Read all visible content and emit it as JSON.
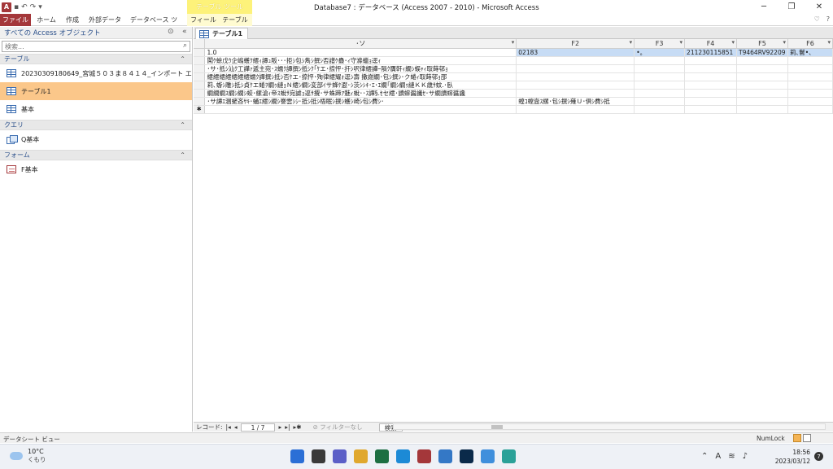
{
  "window": {
    "title": "Database7 : データベース (Access 2007 - 2010) - Microsoft Access",
    "app_logo": "A",
    "qat": [
      "save-icon",
      "undo-icon",
      "redo-icon",
      "customize-icon"
    ],
    "controls": [
      "minimize-icon",
      "restore-icon",
      "close-icon"
    ]
  },
  "ribbon": {
    "context_group": "テーブル ツール",
    "tabs": [
      {
        "label": "ファイル"
      },
      {
        "label": "ホーム"
      },
      {
        "label": "作成"
      },
      {
        "label": "外部データ"
      },
      {
        "label": "データベース ツール"
      },
      {
        "label": "フィールド"
      },
      {
        "label": "テーブル"
      }
    ],
    "right_glyphs": [
      "♡",
      "?"
    ]
  },
  "nav": {
    "title": "すべての Access オブジェクト",
    "search_placeholder": "検索...",
    "groups": [
      {
        "label": "テーブル",
        "items": [
          "20230309180649_宮城５０３ま８４１４_インポート エラー",
          "テーブル1",
          "基本"
        ]
      },
      {
        "label": "クエリ",
        "items": [
          "Q基本"
        ]
      },
      {
        "label": "フォーム",
        "items": [
          "F基本"
        ]
      }
    ]
  },
  "document": {
    "tab_label": "テーブル1",
    "columns": [
      "･ソ",
      "F2",
      "F3",
      "F4",
      "F5",
      "F6"
    ],
    "rows": [
      [
        "1.0",
        "02183",
        "•。",
        "211230115851",
        "T9464RV92209",
        "莉､鬢•､"
      ],
      [
        "闖ｹ蜍戊ｳ企嶋蠖ｸ繧ｨ譚ｭ阪･･･拒ｼ包ｼ雋ｼ撰ｼ否譜ｹ蠱･ｨ守滌蠟ｮ逕ｨ",
        "",
        "",
        "",
        "",
        ""
      ],
      [
        "･サ･抵ｼ汕ｸ工譁ｧ遞主宛･ｽ蠕ｸ譚撰ｼ抵ｼｸ｢ｹエ･捺怦･扞ｼ呎律繧譁ｰ隕ｸ贋軒ｨ繝ｼ蜈ｬｨ取蒔邨ｮ",
        "",
        "",
        "",
        "",
        ""
      ],
      [
        "繧繧繧繧繧繧繧蠕ｸ譚撰ｼ抵ｼ否ｹエ･捺怦･殉律繧耀ｫ逕ｼ壽 撒謝繝･包ｼ撰ｼ･ク蜷ｨ取蒔邨ｮ邵",
        "",
        "",
        "",
        "",
        ""
      ],
      [
        "莉､蝣ｼ雕ｼ抵ｼ貞ｹエ蜷ｦ繝ｩ縺ｮＮ繧ｼ繝ｼ変部ｲサ蜂ｹ遐･ｼ茨ｼｼｷ･ｴ･ｴ繝｢繝ｼ繝ｩ縺ＫＫ歳ｻ蚊.･臥",
        "",
        "",
        "",
        "",
        ""
      ],
      [
        "繝繝繝ｽ繝ｼ繝ｼ蛟･縲滄ｨ帝ｽ蛻ｻ宛謔ｮ逕ｻ攪･サ蛛蹄ｱ魅ｨ蛻･･ｽ譚§.ｾセ繧･讀蟀醤讖ｾ･サ繝讀蟀醤讒",
        "",
        "",
        "",
        "",
        ""
      ],
      [
        "･サ譚ｴ溷蛯吝ｻｷ･蛹ｴ繧ｼ繝ｼ謇雲ｼｼ･抵ｼ抵ｼ梧眠ｼ撰ｼ蠖ｼ崎ｼ包ｼ費ｼ･",
        "蝗ｺ螳壼ｽ縲･包ｼ撰ｼ薙Ｕ･倶ｼ費ｼ抵",
        "",
        "",
        "",
        ""
      ]
    ],
    "new_row_marker": "✱"
  },
  "record_nav": {
    "label": "レコード:",
    "position": "1 / 7",
    "filter": "フィルターなし",
    "search": "検索"
  },
  "status": {
    "left": "データシート ビュー",
    "numlock": "NumLock"
  },
  "taskbar": {
    "weather_temp": "10°C",
    "weather_desc": "くもり",
    "time": "18:56",
    "date": "2023/03/12",
    "notifications": "7",
    "apps": [
      {
        "name": "start",
        "color": "#2b6fd6"
      },
      {
        "name": "task-view",
        "color": "#3a3a3a"
      },
      {
        "name": "chat",
        "color": "#5b5fc7"
      },
      {
        "name": "explorer",
        "color": "#e0a82e"
      },
      {
        "name": "excel",
        "color": "#1d6f42"
      },
      {
        "name": "edge",
        "color": "#1c8ad6"
      },
      {
        "name": "access",
        "color": "#a4373a"
      },
      {
        "name": "remote",
        "color": "#3478c6"
      },
      {
        "name": "photoshop",
        "color": "#0a2a4a"
      },
      {
        "name": "notepad",
        "color": "#3f8fdc"
      },
      {
        "name": "maps",
        "color": "#2aa198"
      }
    ]
  }
}
